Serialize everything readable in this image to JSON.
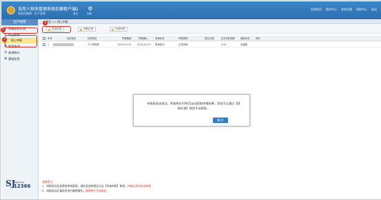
{
  "header": {
    "title": "自然人税收管理系统扣缴客户端",
    "subtitle": "税款所属期 · 生产经营",
    "icons": [
      {
        "name": "home",
        "caption": "首页"
      },
      {
        "name": "settings",
        "caption": "设置"
      }
    ],
    "right_links": [
      "回到首页",
      "操作中心",
      "系统设置",
      "帮助中心",
      "退出"
    ]
  },
  "sidebar": {
    "title": "生产经营",
    "items": [
      {
        "label": "预缴纳税申报",
        "icon": "doc-icon"
      },
      {
        "label": "网上报税",
        "icon": "net-icon"
      },
      {
        "label": "报表查询",
        "icon": "query-icon"
      },
      {
        "label": "查询统计",
        "icon": "stats-icon"
      },
      {
        "label": "基础信息",
        "icon": "info-icon"
      }
    ],
    "sub_item": "网上申报",
    "brand": {
      "mark": "SJ",
      "caption": "纳税服务热线",
      "number": "12366"
    }
  },
  "breadcrumb": "首页 >> 网上申报",
  "badges": [
    "1",
    "2",
    "3"
  ],
  "toolbar": {
    "buttons": [
      "发送申报",
      "获取反馈",
      "作废申报"
    ]
  },
  "grid": {
    "headers": [
      "序号",
      "征收品目",
      "征收项目",
      "所属期起",
      "所属期止",
      "申报状态",
      "申报类型",
      "是否已缴",
      "应补(退)税额",
      "缴款状态",
      "操作"
    ],
    "rows": [
      {
        "no": "1",
        "subject": "",
        "item": "个人所得税",
        "start": "2016-01-01",
        "end": "2016-02-29",
        "status": "申报成功",
        "type": "正常申报",
        "paid": "",
        "amount": "0.00",
        "pay_status": "未缴款",
        "action": ""
      }
    ]
  },
  "dialog": {
    "message": "申报表发送成功，系统将在10秒后自动获取申报结果，您也可以通过【获取反馈】按钮手动获取。",
    "ok_label": "确 定"
  },
  "notes": {
    "title": "温馨提示：",
    "line1_prefix": "1、申报成功后若需修改申报表，请在发送申报后点击【作废申报】按钮，",
    "line1_highlight": "作废后再次发送申报",
    "line2_prefix": "2、申报成功后请及时进行缴税操作，",
    "line2_highlight": "逾期将产生滞纳金"
  }
}
